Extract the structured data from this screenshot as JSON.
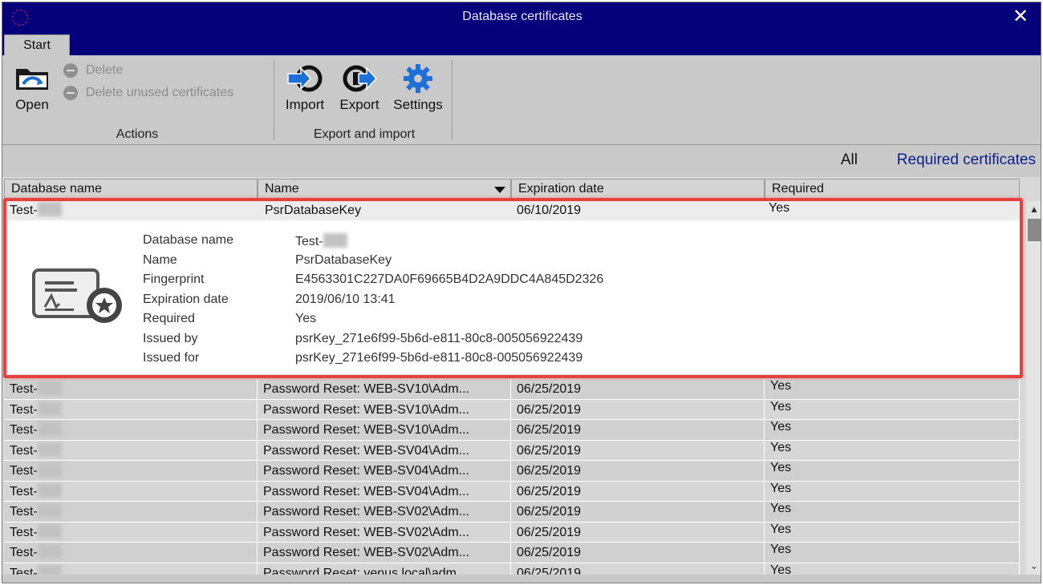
{
  "window": {
    "title": "Database certificates",
    "close_glyph": "✕"
  },
  "tabs": [
    {
      "label": "Start"
    }
  ],
  "ribbon": {
    "actions": {
      "label": "Actions",
      "open_label": "Open",
      "delete_label": "Delete",
      "delete_unused_label": "Delete unused certificates"
    },
    "export_import": {
      "label": "Export and import",
      "import_label": "Import",
      "export_label": "Export",
      "settings_label": "Settings"
    }
  },
  "filter": {
    "all_label": "All",
    "required_label": "Required certificates"
  },
  "table": {
    "columns": [
      "Database name",
      "Name",
      "Expiration date",
      "Required"
    ],
    "rows": [
      {
        "db": "Test-",
        "name": "PsrDatabaseKey",
        "date": "06/10/2019",
        "required": "Yes"
      },
      {
        "db": "Test-",
        "name": "Password Reset: WEB-SV10\\Adm...",
        "date": "06/25/2019",
        "required": "Yes"
      },
      {
        "db": "Test-",
        "name": "Password Reset: WEB-SV10\\Adm...",
        "date": "06/25/2019",
        "required": "Yes"
      },
      {
        "db": "Test-",
        "name": "Password Reset: WEB-SV10\\Adm...",
        "date": "06/25/2019",
        "required": "Yes"
      },
      {
        "db": "Test-",
        "name": "Password Reset: WEB-SV04\\Adm...",
        "date": "06/25/2019",
        "required": "Yes"
      },
      {
        "db": "Test-",
        "name": "Password Reset: WEB-SV04\\Adm...",
        "date": "06/25/2019",
        "required": "Yes"
      },
      {
        "db": "Test-",
        "name": "Password Reset: WEB-SV04\\Adm...",
        "date": "06/25/2019",
        "required": "Yes"
      },
      {
        "db": "Test-",
        "name": "Password Reset: WEB-SV02\\Adm...",
        "date": "06/25/2019",
        "required": "Yes"
      },
      {
        "db": "Test-",
        "name": "Password Reset: WEB-SV02\\Adm...",
        "date": "06/25/2019",
        "required": "Yes"
      },
      {
        "db": "Test-",
        "name": "Password Reset: WEB-SV02\\Adm...",
        "date": "06/25/2019",
        "required": "Yes"
      },
      {
        "db": "Test-",
        "name": "Password Reset: venus.local\\adm...",
        "date": "06/25/2019",
        "required": "Yes"
      }
    ]
  },
  "details": {
    "fields": [
      {
        "label": "Database name",
        "value": "Test-"
      },
      {
        "label": "Name",
        "value": "PsrDatabaseKey"
      },
      {
        "label": "Fingerprint",
        "value": "E4563301C227DA0F69665B4D2A9DDC4A845D2326"
      },
      {
        "label": "Expiration date",
        "value": "2019/06/10 13:41"
      },
      {
        "label": "Required",
        "value": "Yes"
      },
      {
        "label": "Issued by",
        "value": "psrKey_271e6f99-5b6d-e811-80c8-005056922439"
      },
      {
        "label": "Issued for",
        "value": "psrKey_271e6f99-5b6d-e811-80c8-005056922439"
      }
    ]
  },
  "icons": {
    "app": "app-icon",
    "open": "open-folder-icon",
    "delete": "minus-circle-icon",
    "import": "import-icon",
    "export": "export-icon",
    "settings": "gear-icon",
    "certificate": "certificate-icon"
  },
  "colors": {
    "titlebar": "#06007a",
    "accent_link": "#0a1f8a",
    "highlight": "#e8403f"
  }
}
